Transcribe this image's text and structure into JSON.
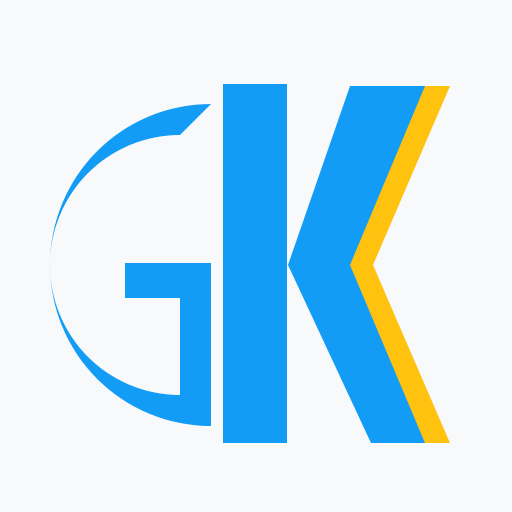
{
  "logo": {
    "text": "GK",
    "icon": "gk-monogram-logo",
    "colors": {
      "background": "#f8f9fb",
      "primary_blue": "#139cf5",
      "accent_yellow": "#ffc20e"
    }
  }
}
